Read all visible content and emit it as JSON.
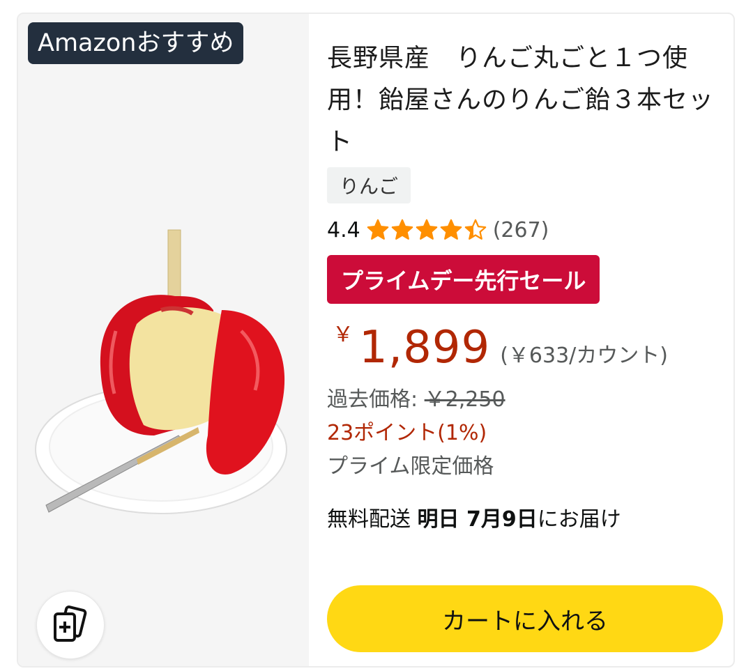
{
  "badge": "Amazonおすすめ",
  "title": "長野県産　りんご丸ごと１つ使用！飴屋さんのりんご飴３本セット",
  "category_chip": "りんご",
  "rating": {
    "value": "4.4",
    "stars": 4.4,
    "count": "(267)",
    "star_color": "#ff8f00"
  },
  "deal_badge": "プライムデー先行セール",
  "price": {
    "currency": "￥",
    "amount": "1,899",
    "unit_price": "(￥633/カウント)",
    "past_label": "過去価格: ",
    "past_value": "￥2,250"
  },
  "points": "23ポイント(1%)",
  "prime_label": "プライム限定価格",
  "delivery": {
    "prefix": "無料配送 ",
    "date": "明日 7月9日",
    "suffix": "にお届け"
  },
  "cart_button": "カートに入れる",
  "icons": {
    "compare": "compare-cards-icon",
    "star": "star-icon"
  },
  "colors": {
    "badge_bg": "#232f3e",
    "deal_red": "#cc0c39",
    "price_red": "#b12704",
    "cart_yellow": "#ffd814"
  }
}
